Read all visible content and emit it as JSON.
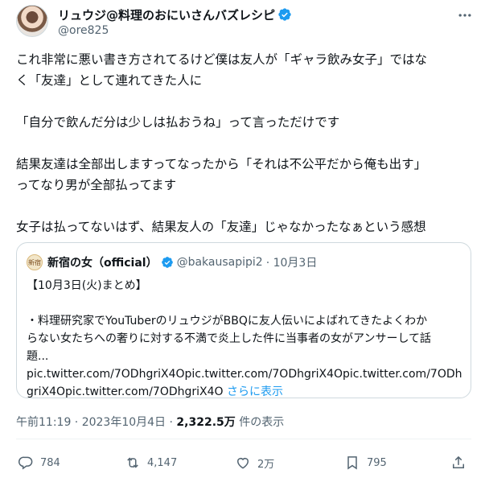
{
  "author": {
    "display_name": "リュウジ@料理のおにいさんバズレシピ",
    "handle": "@ore825"
  },
  "tweet": {
    "lines": [
      "これ非常に悪い書き方されてるけど僕は友人が「ギャラ飲み女子」ではな",
      "く「友達」として連れてきた人に",
      "",
      "「自分で飲んだ分は少しは払おうね」って言っただけです",
      "",
      "結果友達は全部出しますってなったから「それは不公平だから俺も出す」",
      "ってなり男が全部払ってます",
      "",
      "女子は払ってないはず、結果友人の「友達」じゃなかったなぁという感想"
    ]
  },
  "quote": {
    "avatar_text": "新宿",
    "name": "新宿の女（official）",
    "handle": "@bakausapipi2",
    "date": "· 10月3日",
    "lines": [
      "【10月3日(火)まとめ】",
      "",
      "・料理研究家でYouTuberのリュウジがBBQに友人伝いによばれてきたよくわか",
      "らない女たちへの奢りに対する不満で炎上した件に当事者の女がアンサーして話",
      "題...",
      "pic.twitter.com/7ODhgriX4Opic.twitter.com/7ODhgriX4Opic.twitter.com/7ODh"
    ],
    "last_line": "griX4Opic.twitter.com/7ODhgriX4O",
    "show_more": "さらに表示"
  },
  "meta": {
    "time": "午前11:19 · 2023年10月4日 · ",
    "views": "2,322.5万",
    "views_label": " 件の表示"
  },
  "actions": {
    "reply_count": "784",
    "retweet_count": "4,147",
    "like_count": "2万",
    "bookmark_count": "795"
  },
  "colors": {
    "accent": "#1d9bf0",
    "secondary_text": "#536471",
    "border": "#cfd9de",
    "verified_badge": "#1d9bf0"
  },
  "icons": [
    "verified-badge-icon",
    "more-dots-icon",
    "reply-icon",
    "retweet-icon",
    "like-icon",
    "bookmark-icon",
    "share-icon"
  ]
}
